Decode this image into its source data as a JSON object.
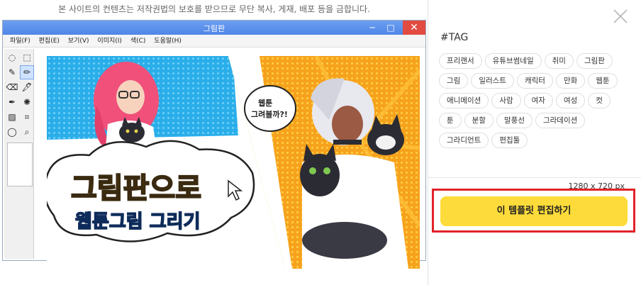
{
  "notice": "본 사이트의 컨텐츠는 저작권법의 보호를 받으므로 무단 복사, 게재, 배포 등을 금합니다.",
  "paint": {
    "title": "그림판",
    "window_controls": {
      "minimize": "─",
      "maximize": "□",
      "close": "✕"
    },
    "menu": [
      "파일(F)",
      "편집(E)",
      "보기(V)",
      "이미지(I)",
      "색(C)",
      "도움말(H)"
    ],
    "tools": [
      "◌",
      "⬚",
      "✎",
      "✏",
      "⌫",
      "🖋",
      "✒",
      "✺",
      "▨",
      "⌗",
      "◯",
      "⌕"
    ]
  },
  "artwork": {
    "headline": "그림판으로",
    "subline": "웹툰그림 그리기",
    "speech": "웹툰\n그려볼까?!"
  },
  "sidebar": {
    "tag_heading": "#TAG",
    "tags": [
      "프리랜서",
      "유튜브썸네일",
      "취미",
      "그림판",
      "그림",
      "일러스트",
      "캐릭터",
      "만화",
      "웹툰",
      "애니메이션",
      "사람",
      "여자",
      "여성",
      "컷",
      "툰",
      "분할",
      "말풍선",
      "그라데이션",
      "그라디언트",
      "편집툴"
    ],
    "dimensions": "1280 x 720 px",
    "edit_button": "이 템플릿 편집하기"
  },
  "colors": {
    "accent_button": "#fddb3a",
    "highlight_border": "#e2232a",
    "titlebar": "#5a8eea"
  }
}
